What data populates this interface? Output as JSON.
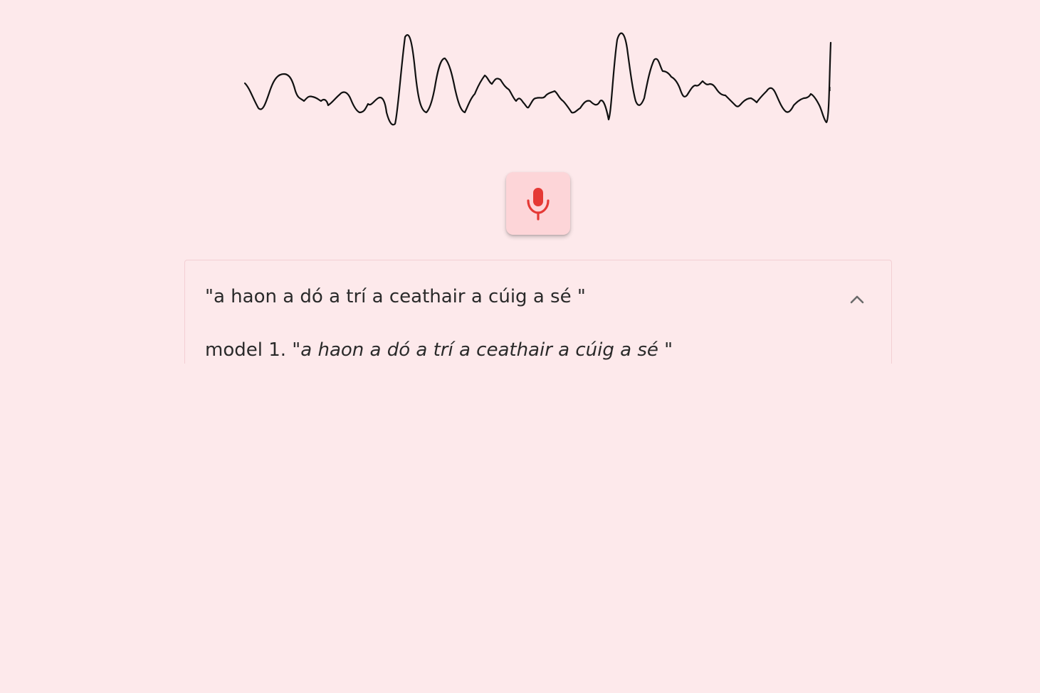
{
  "audio": {
    "waveform_icon": "audio-waveform",
    "stroke_color": "#111111"
  },
  "mic_button": {
    "icon": "microphone-icon",
    "icon_color": "#e53935",
    "background": "#fdd5d8"
  },
  "results": {
    "transcript": "\"a haon a dó a trí a ceathair a cúig a sé \"",
    "toggle_icon": "chevron-up-icon",
    "models": [
      {
        "prefix": "model 1. \"",
        "text": "a haon a dó a trí a ceathair a cúig a sé",
        "suffix": " \""
      }
    ]
  },
  "colors": {
    "background": "#fde9eb",
    "card_border": "#f3cfd3",
    "text": "#2a2a2a"
  }
}
